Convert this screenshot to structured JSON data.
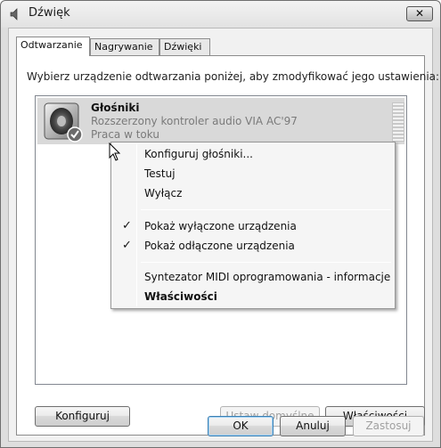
{
  "window": {
    "title": "Dźwięk",
    "close_label": "✕"
  },
  "tabs": [
    {
      "label": "Odtwarzanie",
      "active": true
    },
    {
      "label": "Nagrywanie",
      "active": false
    },
    {
      "label": "Dźwięki",
      "active": false
    }
  ],
  "panel": {
    "instruction": "Wybierz urządzenie odtwarzania poniżej, aby zmodyfikować jego ustawienia:"
  },
  "device": {
    "name": "Głośniki",
    "description": "Rozszerzony kontroler audio VIA AC'97",
    "status": "Praca w toku",
    "icon": "speaker-icon",
    "default_badge_icon": "check-badge-icon"
  },
  "context_menu": {
    "items": [
      {
        "label": "Konfiguruj głośniki...",
        "checked": false,
        "bold": false
      },
      {
        "label": "Testuj",
        "checked": false,
        "bold": false
      },
      {
        "label": "Wyłącz",
        "checked": false,
        "bold": false
      },
      {
        "label": "Pokaż wyłączone urządzenia",
        "checked": true,
        "bold": false
      },
      {
        "label": "Pokaż odłączone urządzenia",
        "checked": true,
        "bold": false
      },
      {
        "label": "Syntezator MIDI oprogramowania - informacje",
        "checked": false,
        "bold": false
      },
      {
        "label": "Właściwości",
        "checked": false,
        "bold": true
      }
    ],
    "check_glyph": "✓"
  },
  "panel_buttons": {
    "configure": "Konfiguruj",
    "set_default": "Ustaw domyślne",
    "properties": "Właściwości"
  },
  "dialog_buttons": {
    "ok": "OK",
    "cancel": "Anuluj",
    "apply": "Zastosuj"
  }
}
